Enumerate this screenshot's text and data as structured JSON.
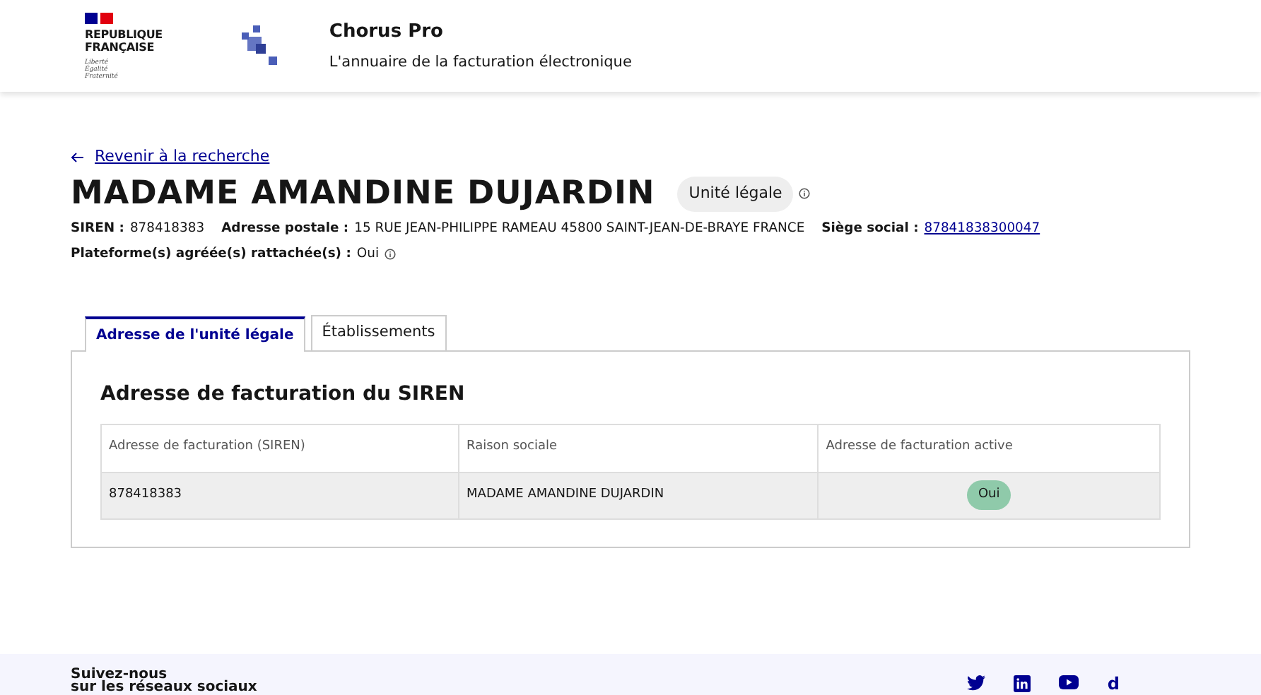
{
  "header": {
    "republic_lines": [
      "REPUBLIQUE",
      "FRANÇAISE"
    ],
    "motto": [
      "Liberté",
      "Égalité",
      "Fraternité"
    ],
    "title": "Chorus Pro",
    "subtitle": "L'annuaire de la facturation électronique"
  },
  "back_link": "Revenir à la recherche",
  "entity": {
    "name": "MADAME AMANDINE DUJARDIN",
    "badge": "Unité légale",
    "fields": [
      {
        "label": "SIREN :",
        "value": "878418383",
        "kind": "text"
      },
      {
        "label": "Adresse postale :",
        "value": "15 RUE JEAN-PHILIPPE RAMEAU 45800 SAINT-JEAN-DE-BRAYE FRANCE",
        "kind": "text"
      },
      {
        "label": "Siège social :",
        "value": "87841838300047",
        "kind": "link"
      }
    ],
    "platform": {
      "label": "Plateforme(s) agréée(s) rattachée(s) :",
      "value": "Oui"
    }
  },
  "tabs": [
    {
      "label": "Adresse de l'unité légale",
      "selected": true
    },
    {
      "label": "Établissements",
      "selected": false
    }
  ],
  "panel": {
    "title": "Adresse de facturation du SIREN",
    "table": {
      "columns": [
        "Adresse de facturation (SIREN)",
        "Raison sociale",
        "Adresse de facturation active"
      ],
      "rows": [
        [
          "878418383",
          "MADAME AMANDINE DUJARDIN",
          "Oui"
        ]
      ]
    }
  },
  "footer": {
    "lines": [
      "Suivez-nous",
      "sur les réseaux sociaux"
    ],
    "social": [
      {
        "kind": "twitter"
      },
      {
        "kind": "linkedin"
      },
      {
        "kind": "youtube"
      },
      {
        "kind": "glyph",
        "text": "d"
      }
    ]
  }
}
